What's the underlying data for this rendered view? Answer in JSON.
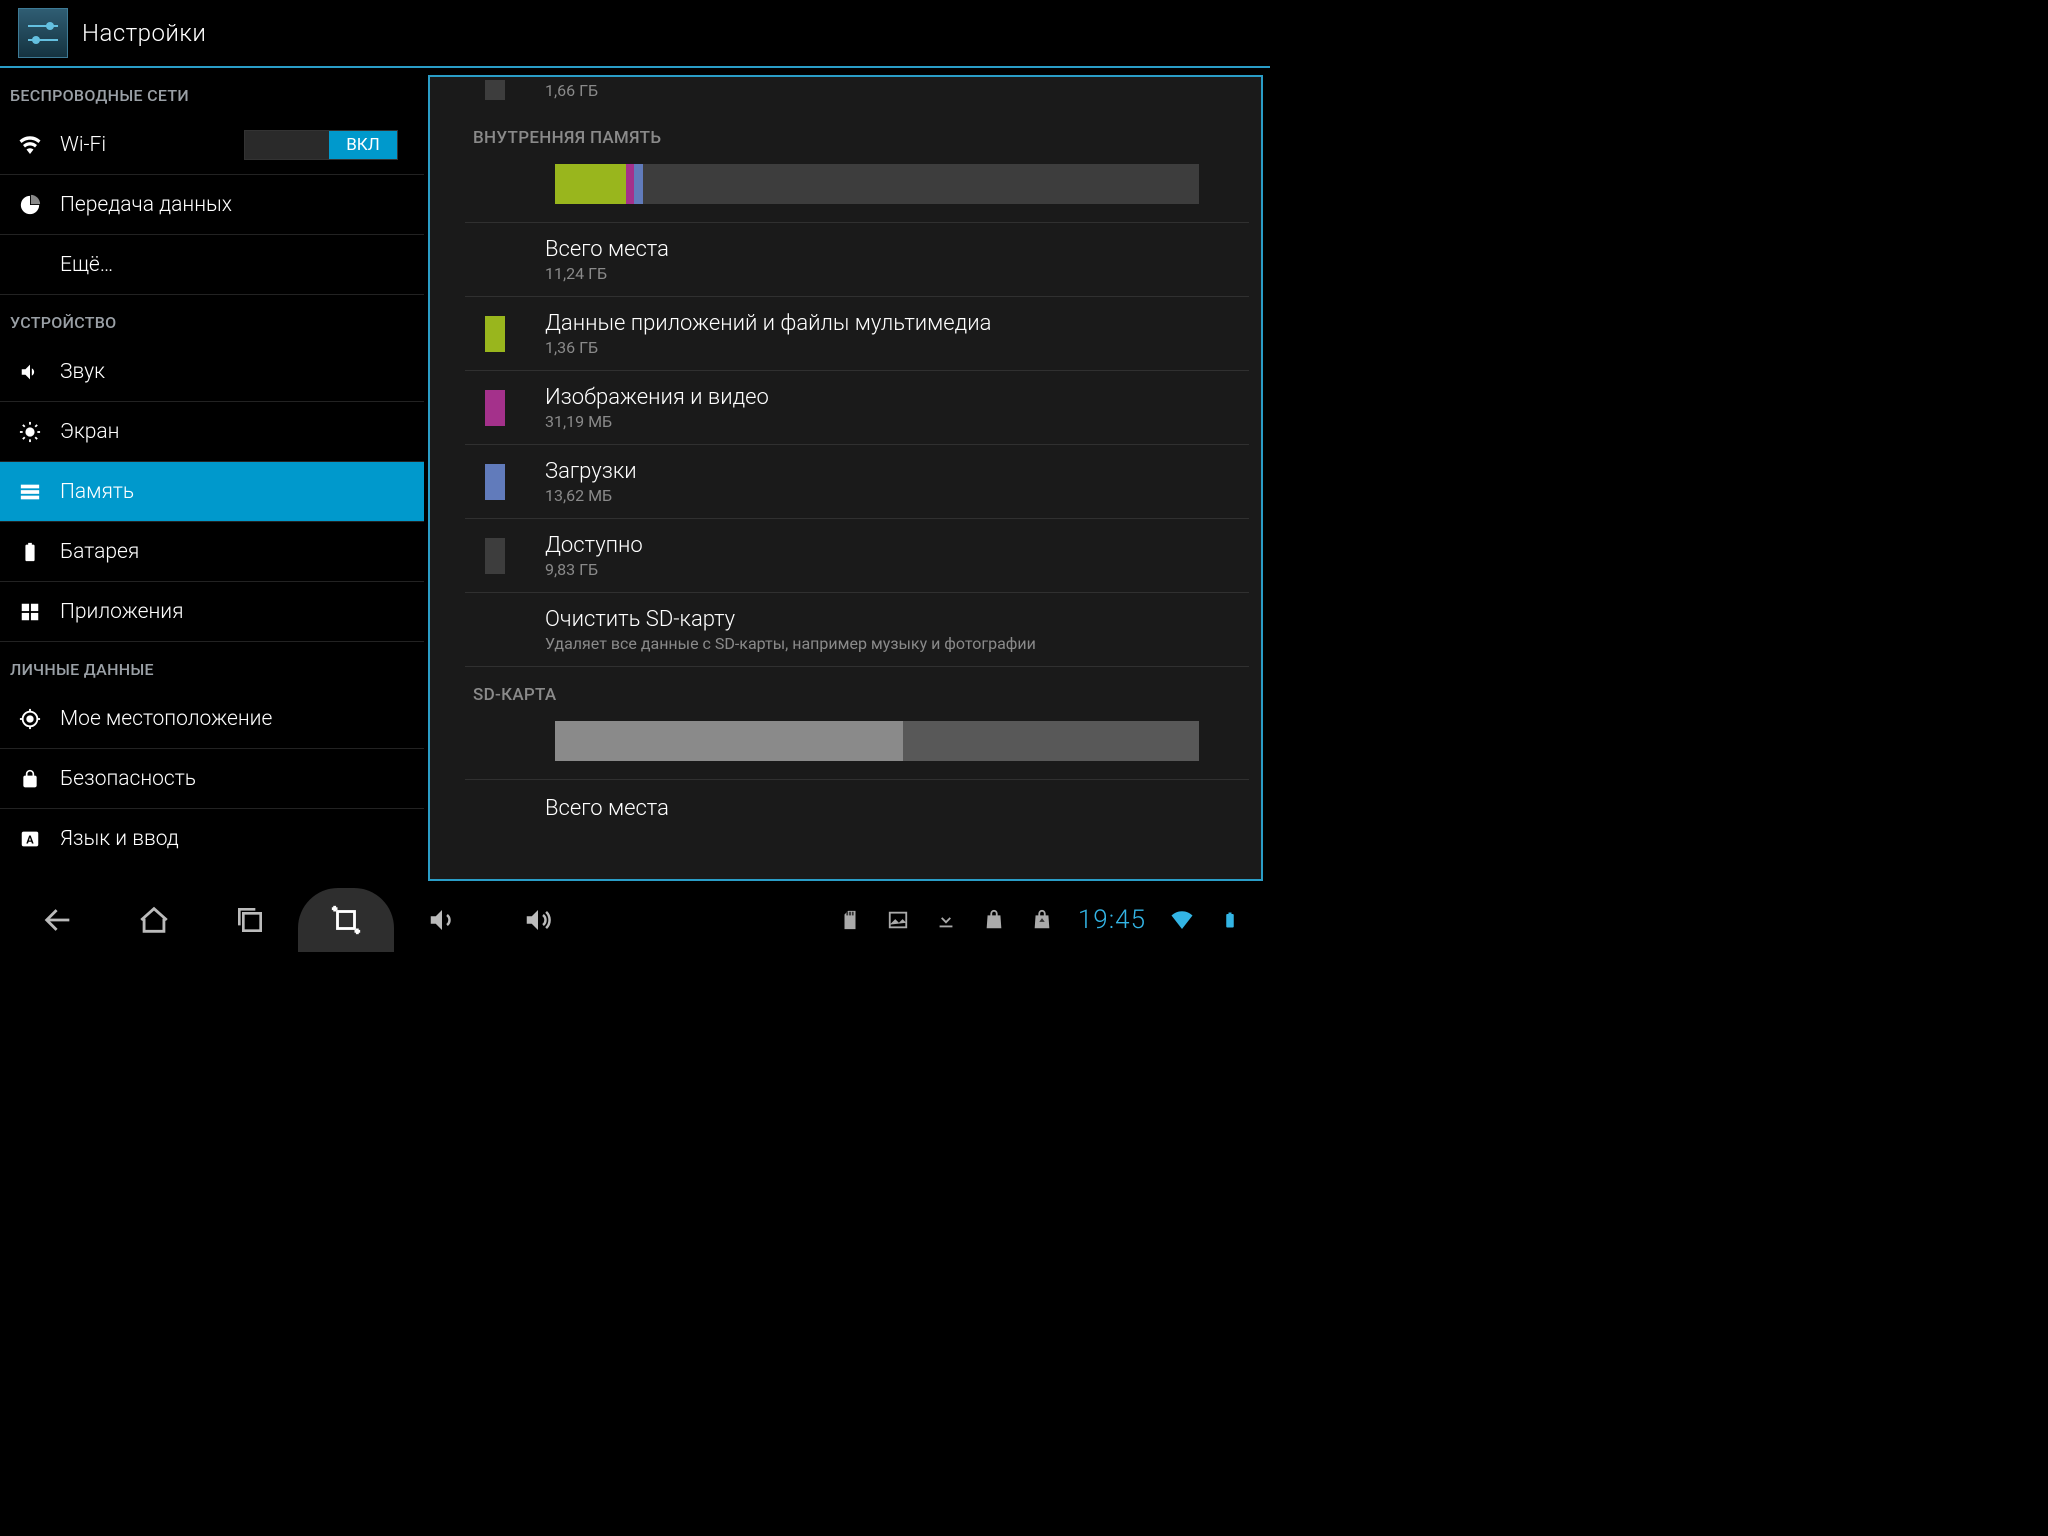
{
  "header": {
    "title": "Настройки"
  },
  "sidebar": {
    "cat_wireless": "БЕСПРОВОДНЫЕ СЕТИ",
    "wifi": "Wi-Fi",
    "wifi_toggle": "ВКЛ",
    "data": "Передача данных",
    "more": "Ещё…",
    "cat_device": "УСТРОЙСТВО",
    "sound": "Звук",
    "display": "Экран",
    "storage": "Память",
    "battery": "Батарея",
    "apps": "Приложения",
    "cat_personal": "ЛИЧНЫЕ ДАННЫЕ",
    "location": "Мое местоположение",
    "security": "Безопасность",
    "language": "Язык и ввод"
  },
  "content": {
    "top_size": "1,66 ГБ",
    "section_internal": "ВНУТРЕННЯЯ ПАМЯТЬ",
    "section_sd": "SD-КАРТА",
    "total_label": "Всего места",
    "total_value": "11,24 ГБ",
    "apps_label": "Данные приложений и файлы мультимедиа",
    "apps_value": "1,36 ГБ",
    "pics_label": "Изображения и видео",
    "pics_value": "31,19 МБ",
    "downloads_label": "Загрузки",
    "downloads_value": "13,62 МБ",
    "avail_label": "Доступно",
    "avail_value": "9,83 ГБ",
    "erase_label": "Очистить SD-карту",
    "erase_sub": "Удаляет все данные с SD-карты, например музыку и фотографии",
    "sd_total_label": "Всего места"
  },
  "bar": {
    "segments": [
      {
        "color": "#99b61d",
        "pct": 11
      },
      {
        "color": "#a4318b",
        "pct": 1.2
      },
      {
        "color": "#617bbb",
        "pct": 1.4
      }
    ]
  },
  "sd_bar_used_pct": 54,
  "swatches": {
    "apps": "#99b61d",
    "pics": "#a4318b",
    "downloads": "#617bbb",
    "avail": "#3d3d3d",
    "top": "#3d3d3d"
  },
  "navbar": {
    "clock": "19:45"
  }
}
